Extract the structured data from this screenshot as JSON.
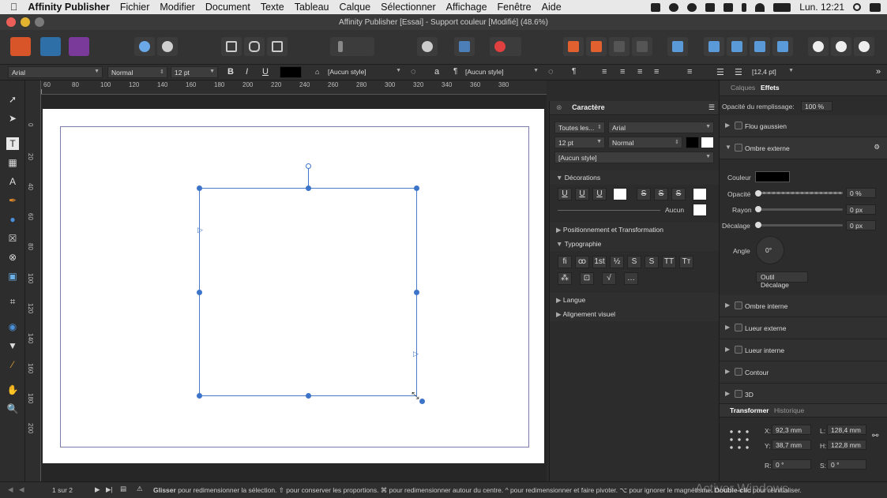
{
  "menubar": {
    "app": "Affinity Publisher",
    "items": [
      "Fichier",
      "Modifier",
      "Document",
      "Texte",
      "Tableau",
      "Calque",
      "Sélectionner",
      "Affichage",
      "Fenêtre",
      "Aide"
    ],
    "clock": "Lun. 12:21"
  },
  "window": {
    "title": "Affinity Publisher [Essai] - Support couleur [Modifié] (48.6%)"
  },
  "ctx": {
    "font": "Arial",
    "weight": "Normal",
    "size": "12 pt",
    "para_style": "[Aucun style]",
    "char_style": "[Aucun style]",
    "leading": "[12,4 pt]",
    "bold": "B",
    "italic": "I",
    "underline": "U"
  },
  "ruler": {
    "labels": [
      "60",
      "80",
      "100",
      "120",
      "140",
      "160",
      "180",
      "200",
      "220",
      "240",
      "260",
      "280",
      "300",
      "320",
      "340",
      "360",
      "380"
    ],
    "left_labels": [
      "0",
      "20",
      "40",
      "60",
      "80",
      "100",
      "120",
      "140",
      "160",
      "180",
      "200"
    ]
  },
  "character_panel": {
    "title": "Caractère",
    "selector": "Toutes les...",
    "font": "Arial",
    "size": "12 pt",
    "weight": "Normal",
    "style": "[Aucun style]",
    "decorations": "Décorations",
    "decoration_none": "Aucun",
    "positioning": "Positionnement et Transformation",
    "typography": "Typographie",
    "language": "Langue",
    "visual_alignment": "Alignement visuel",
    "deco_buttons": [
      "U",
      "U",
      "U",
      "S",
      "S",
      "S"
    ],
    "typo_buttons": [
      "fi",
      "ꝏ",
      "1st",
      "½",
      "S",
      "S",
      "TT",
      "Tт"
    ]
  },
  "fx_panel": {
    "tabs": [
      "Calques",
      "Effets"
    ],
    "opacity_label": "Opacité du remplissage:",
    "opacity_value": "100 %",
    "effects": [
      {
        "label": "Flou gaussien"
      },
      {
        "label": "Ombre externe"
      },
      {
        "label": "Ombre interne"
      },
      {
        "label": "Lueur externe"
      },
      {
        "label": "Lueur interne"
      },
      {
        "label": "Contour"
      },
      {
        "label": "3D"
      }
    ],
    "color_label": "Couleur",
    "opacity2_label": "Opacité",
    "opacity2_value": "0 %",
    "radius_label": "Rayon",
    "radius_value": "0 px",
    "offset_label": "Décalage",
    "offset_value": "0 px",
    "angle_label": "Angle",
    "angle_value": "0°",
    "tool_button": "Outil Décalage"
  },
  "transform": {
    "tabs": [
      "Transformer",
      "Historique"
    ],
    "x": "92,3 mm",
    "y": "38,7 mm",
    "w": "128,4 mm",
    "h": "122,8 mm",
    "r": "0 °",
    "s": "0 °",
    "xl": "X:",
    "yl": "Y:",
    "wl": "L:",
    "hl": "H:",
    "rl": "R:",
    "sl": "S:"
  },
  "status": {
    "pages": "1 sur 2",
    "bold": "Glisser",
    "text": "pour redimensionner la sélection. ⇧ pour conserver les proportions. ⌘ pour redimensionner autour du centre. ^ pour redimensionner et faire pivoter. ⌥ pour ignorer le magnétisme.",
    "bold2": "Double-clic",
    "text2": "pour réinitialiser.",
    "watermark": "Activer Windows"
  }
}
